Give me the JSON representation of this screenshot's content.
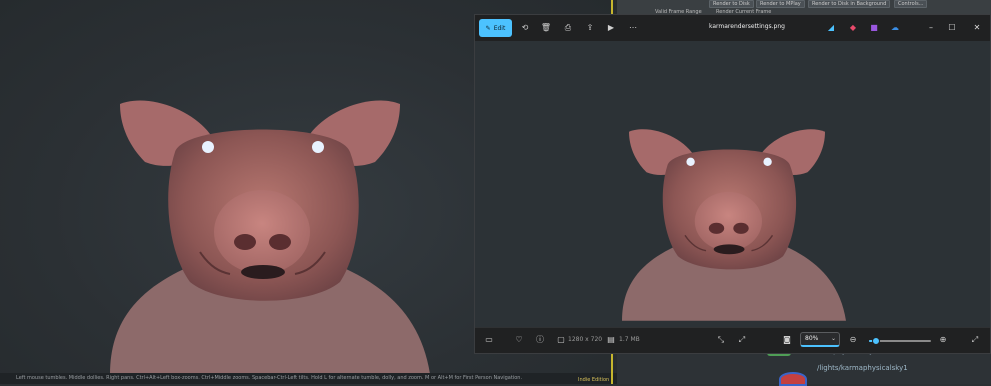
{
  "houdini": {
    "frame_range_label": "Valid Frame Range",
    "render_current_frame": "Render Current Frame",
    "buttons": [
      "Render to Disk",
      "Render to MPlay",
      "Render to Disk in Background",
      "Controls..."
    ],
    "status_hint": "Left mouse tumbles. Middle dollies. Right pans. Ctrl+Alt+Left box-zooms. Ctrl+Middle zooms. Spacebar-Ctrl-Left tilts. Hold L for alternate tumble, dolly, and zoom. M or Alt+M for First Person Navigation.",
    "edition": "Indie Edition",
    "node_path": "/lights/karmaphysicalsky1",
    "node_partial": "maphysicalsky1"
  },
  "photos": {
    "edit_label": "Edit",
    "filename": "karmarendersettings.png",
    "resolution": "1280 x 720",
    "filesize": "1.7 MB",
    "zoom_value": "80%",
    "zoom_fraction": 0.12
  },
  "colors": {
    "accent": "#4cc2ff",
    "houdini_yellow": "#c6b62e"
  }
}
